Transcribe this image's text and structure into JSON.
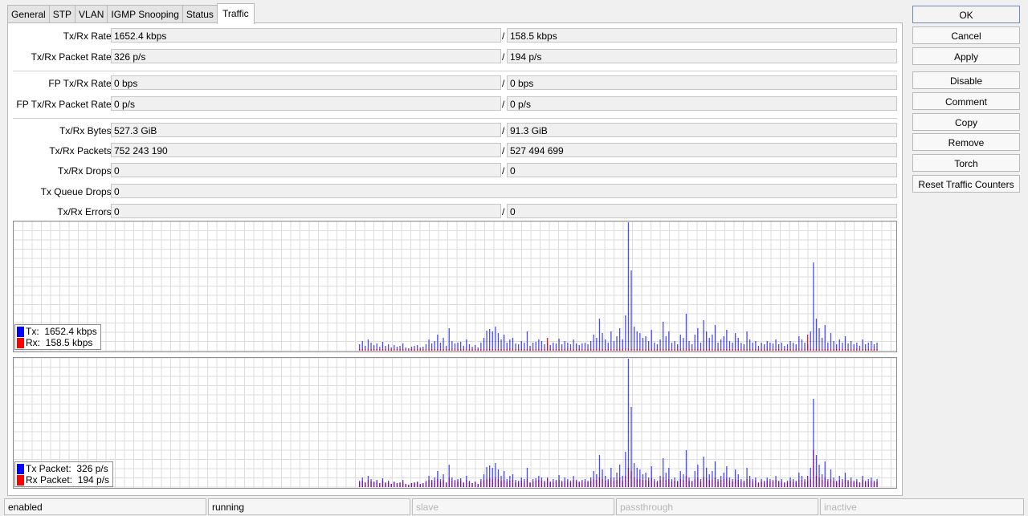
{
  "tabs": [
    "General",
    "STP",
    "VLAN",
    "IGMP Snooping",
    "Status",
    "Traffic"
  ],
  "active_tab": "Traffic",
  "fields": {
    "txrx_rate": {
      "label": "Tx/Rx Rate:",
      "tx": "1652.4 kbps",
      "rx": "158.5 kbps"
    },
    "txrx_packet_rate": {
      "label": "Tx/Rx Packet Rate:",
      "tx": "326 p/s",
      "rx": "194 p/s"
    },
    "fp_txrx_rate": {
      "label": "FP Tx/Rx Rate:",
      "tx": "0 bps",
      "rx": "0 bps"
    },
    "fp_txrx_packet_rate": {
      "label": "FP Tx/Rx Packet Rate:",
      "tx": "0 p/s",
      "rx": "0 p/s"
    },
    "txrx_bytes": {
      "label": "Tx/Rx Bytes:",
      "tx": "527.3 GiB",
      "rx": "91.3 GiB"
    },
    "txrx_packets": {
      "label": "Tx/Rx Packets:",
      "tx": "752 243 190",
      "rx": "527 494 699"
    },
    "txrx_drops": {
      "label": "Tx/Rx Drops:",
      "tx": "0",
      "rx": "0"
    },
    "tx_queue_drops": {
      "label": "Tx Queue Drops:",
      "value": "0"
    },
    "txrx_errors": {
      "label": "Tx/Rx Errors:",
      "tx": "0",
      "rx": "0"
    }
  },
  "slash": "/",
  "graphs": {
    "rate": {
      "legend_tx": "Tx:  1652.4 kbps",
      "legend_rx": "Rx:  158.5 kbps"
    },
    "packet": {
      "legend_tx": "Tx Packet:  326 p/s",
      "legend_rx": "Rx Packet:  194 p/s"
    }
  },
  "colors": {
    "tx": "#0000ff",
    "rx": "#ff0000",
    "overlap": "#8b008b",
    "grid": "#dddddd"
  },
  "buttons": {
    "ok": "OK",
    "cancel": "Cancel",
    "apply": "Apply",
    "disable": "Disable",
    "comment": "Comment",
    "copy": "Copy",
    "remove": "Remove",
    "torch": "Torch",
    "reset_counters": "Reset Traffic Counters"
  },
  "status": [
    "enabled",
    "running",
    "slave",
    "passthrough",
    "inactive"
  ],
  "chart_data": [
    {
      "type": "bar",
      "title": "",
      "grid": true,
      "series": [
        {
          "name": "Tx",
          "values": [
            8,
            12,
            6,
            14,
            10,
            7,
            9,
            5,
            11,
            6,
            8,
            4,
            7,
            5,
            6,
            9,
            4,
            3,
            5,
            6,
            7,
            4,
            5,
            8,
            14,
            9,
            12,
            20,
            10,
            16,
            6,
            28,
            12,
            9,
            10,
            11,
            6,
            14,
            8,
            5,
            7,
            4,
            10,
            16,
            25,
            27,
            24,
            30,
            22,
            14,
            20,
            10,
            14,
            16,
            9,
            8,
            12,
            10,
            24,
            6,
            10,
            11,
            14,
            12,
            8,
            10,
            7,
            10,
            9,
            15,
            8,
            12,
            10,
            8,
            14,
            9,
            7,
            9,
            10,
            8,
            12,
            20,
            16,
            40,
            22,
            14,
            10,
            24,
            12,
            18,
            28,
            14,
            44,
            160,
            100,
            30,
            24,
            22,
            16,
            18,
            12,
            26,
            10,
            8,
            14,
            36,
            18,
            24,
            10,
            12,
            8,
            20,
            16,
            46,
            12,
            8,
            20,
            28,
            10,
            38,
            24,
            16,
            20,
            32,
            10,
            14,
            18,
            26,
            12,
            10,
            22,
            16,
            10,
            8,
            24,
            14,
            10,
            12,
            6,
            10,
            8,
            12,
            10,
            9,
            14,
            8,
            10,
            6,
            8,
            12,
            10,
            8,
            18,
            14,
            10,
            8,
            24,
            110,
            40,
            28,
            16,
            32,
            10,
            22,
            12,
            8,
            14,
            10,
            18,
            9,
            12,
            8,
            10,
            6,
            14,
            8,
            10,
            12,
            8,
            10
          ]
        },
        {
          "name": "Rx",
          "values": [
            2,
            2,
            2,
            2,
            2,
            2,
            2,
            2,
            2,
            2,
            2,
            2,
            2,
            2,
            2,
            2,
            2,
            2,
            2,
            2,
            2,
            2,
            2,
            2,
            2,
            2,
            2,
            2,
            2,
            2,
            2,
            2,
            2,
            2,
            2,
            2,
            2,
            2,
            2,
            2,
            2,
            2,
            2,
            2,
            2,
            2,
            2,
            2,
            2,
            2,
            2,
            2,
            2,
            2,
            2,
            2,
            2,
            2,
            2,
            2,
            2,
            2,
            2,
            2,
            2,
            16,
            2,
            2,
            2,
            2,
            2,
            2,
            2,
            2,
            2,
            2,
            2,
            2,
            2,
            2,
            2,
            2,
            2,
            2,
            2,
            2,
            2,
            2,
            2,
            2,
            2,
            2,
            2,
            2,
            2,
            2,
            2,
            2,
            2,
            2,
            2,
            2,
            2,
            2,
            2,
            2,
            2,
            2,
            2,
            2,
            2,
            2,
            2,
            2,
            2,
            2,
            2,
            2,
            2,
            2,
            2,
            2,
            2,
            2,
            2,
            2,
            2,
            2,
            2,
            2,
            2,
            2,
            2,
            2,
            2,
            2,
            2,
            2,
            2,
            2,
            2,
            2,
            2,
            2,
            2,
            2,
            2,
            2,
            2,
            2,
            2,
            2,
            2,
            2,
            2,
            20,
            2,
            2,
            2,
            2,
            2,
            2,
            2,
            2,
            2,
            2,
            2,
            2,
            2,
            2,
            2,
            2,
            2,
            2,
            2,
            2,
            2,
            2,
            2,
            2,
            2,
            2,
            2,
            2,
            2
          ]
        }
      ]
    },
    {
      "type": "bar",
      "title": "",
      "grid": true,
      "series": [
        {
          "name": "Tx Packet",
          "values": [
            8,
            12,
            6,
            14,
            10,
            7,
            9,
            5,
            11,
            6,
            8,
            4,
            7,
            5,
            6,
            9,
            4,
            3,
            5,
            6,
            7,
            4,
            5,
            8,
            14,
            9,
            12,
            20,
            10,
            16,
            6,
            28,
            12,
            9,
            10,
            11,
            6,
            14,
            8,
            5,
            7,
            4,
            10,
            16,
            25,
            27,
            24,
            30,
            22,
            14,
            20,
            10,
            14,
            16,
            9,
            8,
            12,
            10,
            24,
            6,
            10,
            11,
            14,
            12,
            8,
            10,
            7,
            10,
            9,
            15,
            8,
            12,
            10,
            8,
            14,
            9,
            7,
            9,
            10,
            8,
            12,
            20,
            16,
            40,
            22,
            14,
            10,
            24,
            12,
            18,
            28,
            14,
            44,
            160,
            100,
            30,
            24,
            22,
            16,
            18,
            12,
            26,
            10,
            8,
            14,
            36,
            18,
            24,
            10,
            12,
            8,
            20,
            16,
            46,
            12,
            8,
            20,
            28,
            10,
            38,
            24,
            16,
            20,
            32,
            10,
            14,
            18,
            26,
            12,
            10,
            22,
            16,
            10,
            8,
            24,
            14,
            10,
            12,
            6,
            10,
            8,
            12,
            10,
            9,
            14,
            8,
            10,
            6,
            8,
            12,
            10,
            8,
            18,
            14,
            10,
            8,
            24,
            110,
            40,
            28,
            16,
            32,
            10,
            22,
            12,
            8,
            14,
            10,
            18,
            9,
            12,
            8,
            10,
            6,
            14,
            8,
            10,
            12,
            8,
            10
          ]
        },
        {
          "name": "Rx Packet",
          "values": [
            6,
            8,
            5,
            9,
            7,
            6,
            7,
            5,
            8,
            5,
            6,
            4,
            6,
            5,
            5,
            7,
            4,
            3,
            5,
            5,
            6,
            4,
            5,
            6,
            9,
            7,
            8,
            10,
            7,
            9,
            5,
            12,
            8,
            7,
            7,
            8,
            5,
            9,
            6,
            5,
            6,
            4,
            7,
            9,
            10,
            11,
            10,
            12,
            10,
            8,
            9,
            7,
            8,
            9,
            6,
            6,
            8,
            7,
            10,
            5,
            7,
            8,
            9,
            8,
            6,
            12,
            6,
            7,
            7,
            9,
            6,
            8,
            7,
            6,
            9,
            7,
            6,
            7,
            7,
            6,
            8,
            10,
            9,
            12,
            10,
            8,
            7,
            11,
            8,
            9,
            12,
            8,
            14,
            24,
            20,
            12,
            10,
            10,
            9,
            9,
            8,
            11,
            7,
            6,
            9,
            12,
            9,
            10,
            7,
            8,
            6,
            10,
            9,
            14,
            8,
            6,
            10,
            12,
            7,
            12,
            11,
            9,
            10,
            12,
            7,
            9,
            10,
            11,
            8,
            7,
            10,
            9,
            7,
            6,
            10,
            9,
            7,
            8,
            5,
            7,
            6,
            8,
            7,
            7,
            9,
            6,
            7,
            5,
            6,
            8,
            7,
            6,
            9,
            9,
            7,
            14,
            10,
            46,
            14,
            12,
            9,
            12,
            7,
            10,
            8,
            6,
            9,
            7,
            9,
            7,
            8,
            6,
            7,
            5,
            9,
            6,
            7,
            8,
            6,
            7
          ]
        }
      ]
    }
  ]
}
